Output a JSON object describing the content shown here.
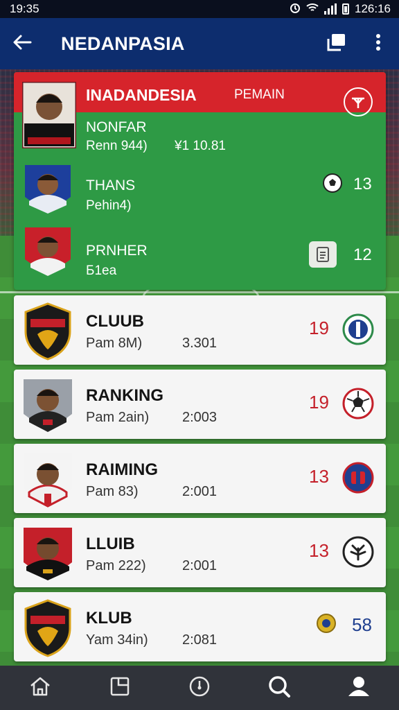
{
  "status_bar": {
    "time": "19:35",
    "right_time": "126:16"
  },
  "app_bar": {
    "title": "NEDANPASIA"
  },
  "featured": {
    "title": "INADANDESIA",
    "subtitle": "PEMAIN",
    "rows": [
      {
        "name": "NONFAR",
        "sub": "Renn 944)",
        "value": "¥1 10.81"
      },
      {
        "name": "THANS",
        "sub": "Pehin4)",
        "number": "13"
      },
      {
        "name": "PRNHER",
        "sub": "Б1ea",
        "number": "12"
      }
    ]
  },
  "list": [
    {
      "name": "CLUUB",
      "sub": "Pam 8M)",
      "year": "3.301",
      "number": "19",
      "badge": "club-crest-icon"
    },
    {
      "name": "RANKING",
      "sub": "Pam 2ain)",
      "year": "2:003",
      "number": "19",
      "badge": "soccer-ball-icon"
    },
    {
      "name": "RAIMING",
      "sub": "Pam 83)",
      "year": "2:001",
      "number": "13",
      "badge": "club-crest-icon"
    },
    {
      "name": "LLUIB",
      "sub": "Pam 222)",
      "year": "2:001",
      "number": "13",
      "badge": "club-crest-icon"
    },
    {
      "name": "KLUB",
      "sub": "Yam 34in)",
      "year": "2:081",
      "number": "58",
      "badge": "medal-icon"
    }
  ],
  "colors": {
    "app_bar": "#0d2d6e",
    "banner_red": "#d6242b",
    "featured_green": "#2e9a45",
    "number_red": "#c4202a",
    "accent_blue": "#1f3f8f"
  },
  "bottom_nav": [
    "home-icon",
    "document-icon",
    "clock-icon",
    "search-icon",
    "profile-icon"
  ]
}
